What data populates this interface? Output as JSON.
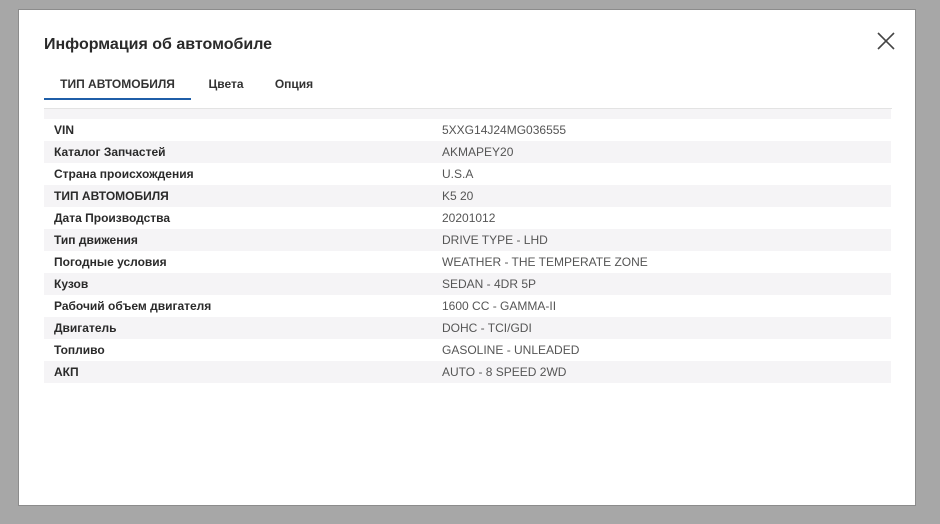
{
  "modal": {
    "title": "Информация об автомобиле"
  },
  "tabs": [
    {
      "label": "ТИП АВТОМОБИЛЯ",
      "active": true
    },
    {
      "label": "Цвета",
      "active": false
    },
    {
      "label": "Опция",
      "active": false
    }
  ],
  "rows": [
    {
      "label": "VIN",
      "value": "5XXG14J24MG036555"
    },
    {
      "label": "Каталог Запчастей",
      "value": "AKMAPEY20"
    },
    {
      "label": "Страна происхождения",
      "value": "U.S.A"
    },
    {
      "label": "ТИП АВТОМОБИЛЯ",
      "value": "K5 20"
    },
    {
      "label": "Дата Производства",
      "value": "20201012"
    },
    {
      "label": "Тип движения",
      "value": "DRIVE TYPE - LHD"
    },
    {
      "label": "Погодные условия",
      "value": "WEATHER - THE TEMPERATE ZONE"
    },
    {
      "label": "Кузов",
      "value": "SEDAN - 4DR 5P"
    },
    {
      "label": "Рабочий объем двигателя",
      "value": "1600 CC - GAMMA-II"
    },
    {
      "label": "Двигатель",
      "value": "DOHC - TCI/GDI"
    },
    {
      "label": "Топливо",
      "value": "GASOLINE - UNLEADED"
    },
    {
      "label": "АКП",
      "value": "AUTO - 8 SPEED 2WD"
    }
  ],
  "colors": {
    "accent": "#1f5ea8",
    "row_alt": "#f5f4f6",
    "overlay": "#a7a7a7"
  },
  "icons": {
    "close": "close-icon"
  }
}
